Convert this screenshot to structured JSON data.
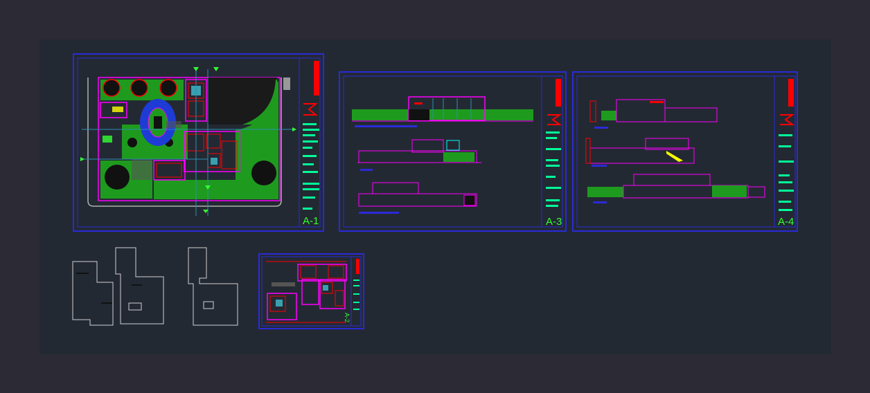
{
  "sheets": {
    "a1": {
      "label": "A-1"
    },
    "a3": {
      "label": "A-3"
    },
    "a4": {
      "label": "A-4"
    },
    "a2": {
      "label": "A-2"
    }
  },
  "colors": {
    "background": "#2c2b35",
    "canvas": "#232933",
    "sheet_border": "#2a2ad8",
    "magenta": "#ff00ff",
    "green": "#1e9b1e",
    "red": "#ff0000",
    "cyan": "#00ffff",
    "white": "#d8d8d8"
  }
}
